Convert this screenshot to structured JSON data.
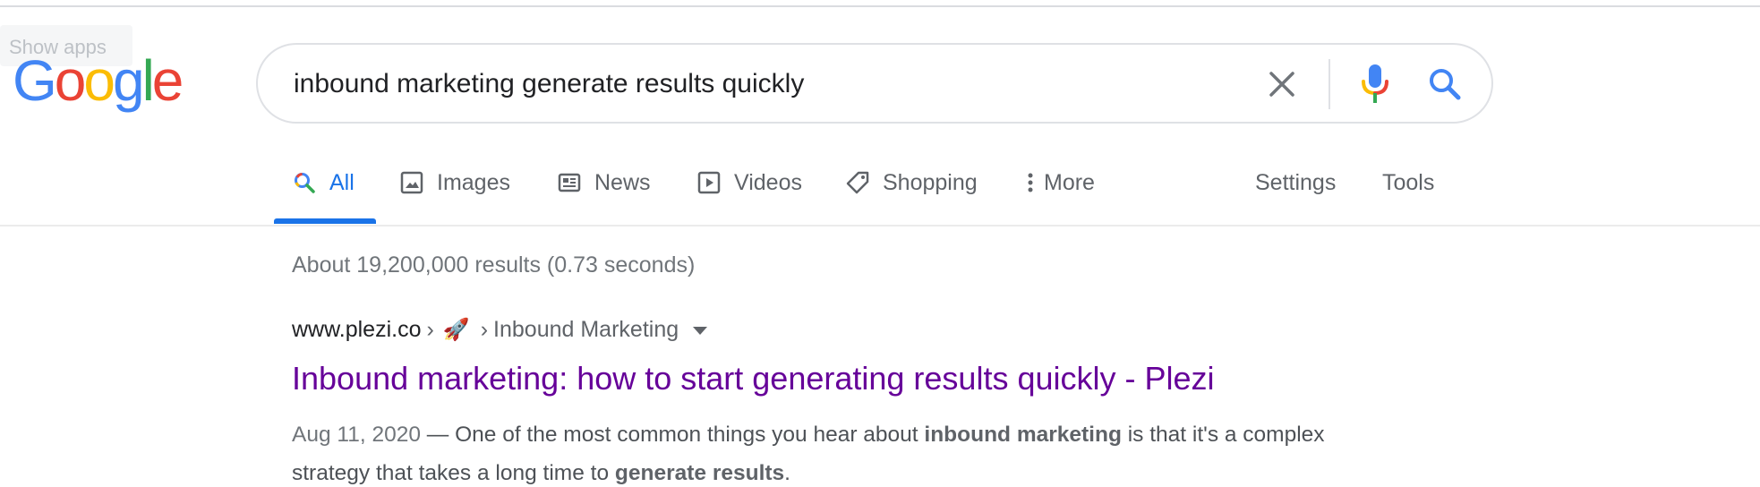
{
  "show_apps_label": "Show apps",
  "logo": {
    "letters": [
      "G",
      "o",
      "o",
      "g",
      "l",
      "e"
    ],
    "colors": [
      "#4285F4",
      "#EA4335",
      "#FBBC05",
      "#4285F4",
      "#34A853",
      "#EA4335"
    ]
  },
  "search": {
    "query": "inbound marketing generate results quickly"
  },
  "tabs": [
    {
      "label": "All",
      "icon": "search-icon"
    },
    {
      "label": "Images",
      "icon": "image-icon"
    },
    {
      "label": "News",
      "icon": "newspaper-icon"
    },
    {
      "label": "Videos",
      "icon": "play-icon"
    },
    {
      "label": "Shopping",
      "icon": "tag-icon"
    },
    {
      "label": "More",
      "icon": "more-vert-icon"
    }
  ],
  "tools": {
    "settings_label": "Settings",
    "tools_label": "Tools"
  },
  "result_stats": "About 19,200,000 results (0.73 seconds)",
  "results": [
    {
      "domain": "www.plezi.co",
      "separator": "›",
      "emoji": "🚀",
      "breadcrumb": "Inbound Marketing",
      "title": "Inbound marketing: how to start generating results quickly - Plezi",
      "date": "Aug 11, 2020",
      "dash": " — ",
      "snippet_parts": [
        "One of the most common things you hear about ",
        "inbound marketing",
        " is that it's a complex strategy that takes a long time to ",
        "generate results",
        "."
      ]
    }
  ],
  "colors": {
    "accent": "#1a73e8",
    "visited_link": "#660099",
    "text_secondary": "#70757a",
    "divider": "#ebebeb"
  }
}
